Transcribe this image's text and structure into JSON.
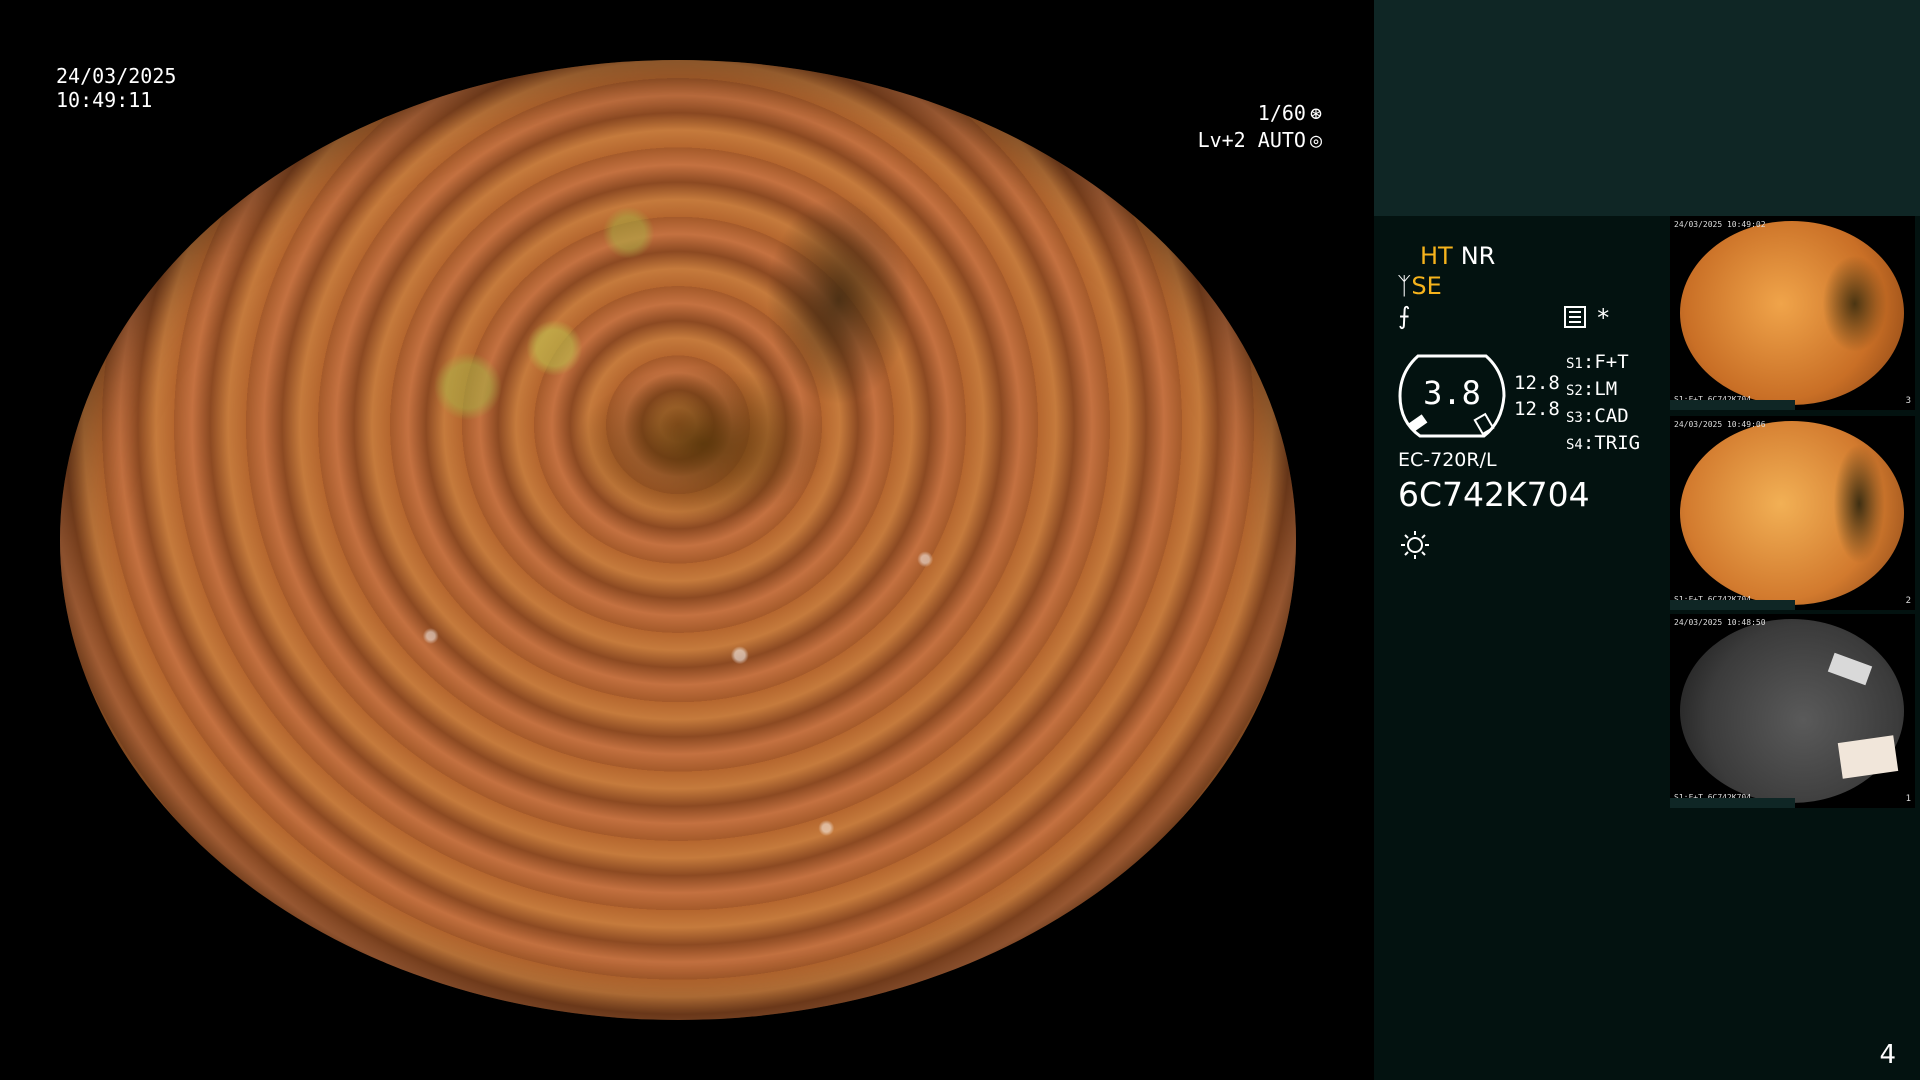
{
  "overlay": {
    "date": "24/03/2025",
    "time": "10:49:11",
    "shutter": "1/60",
    "level": "Lv+2",
    "iris": "AUTO"
  },
  "panel": {
    "mode_ht": "HT",
    "mode_nr": "NR",
    "mode_se": "SE",
    "gauge_value": "3.8",
    "gauge_sub_1": "12.8",
    "gauge_sub_2": "12.8",
    "asterisk": "*",
    "slots": [
      {
        "key": "S1",
        "value": "F+T"
      },
      {
        "key": "S2",
        "value": "LM"
      },
      {
        "key": "S3",
        "value": "CAD"
      },
      {
        "key": "S4",
        "value": "TRIG"
      }
    ],
    "model": "EC-720R/L",
    "serial": "6C742K704"
  },
  "thumbnails": [
    {
      "top_text": "24/03/2025\n10:49:02",
      "bottom_text": "S1:F+T\n6C742K704",
      "index": "3"
    },
    {
      "top_text": "24/03/2025\n10:49:06",
      "bottom_text": "S1:F+T\n6C742K704",
      "index": "2"
    },
    {
      "top_text": "24/03/2025\n10:48:50",
      "bottom_text": "S1:F+T\n6C742K704",
      "index": "1"
    }
  ],
  "page_number": "4"
}
